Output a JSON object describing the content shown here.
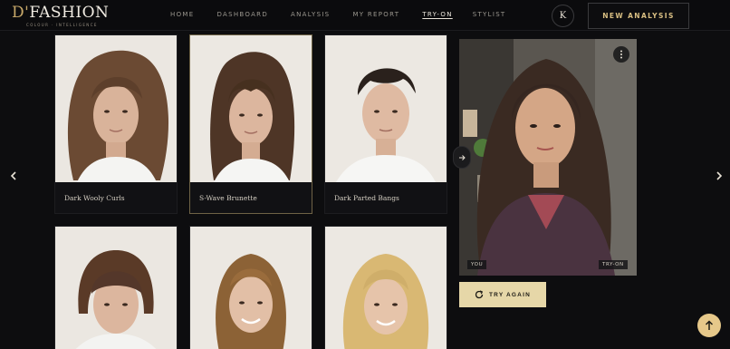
{
  "brand": {
    "name_prefix": "D'",
    "name_rest": "FASHION",
    "tagline": "COLOUR · INTELLIGENCE"
  },
  "nav": {
    "items": [
      {
        "label": "HOME",
        "active": false
      },
      {
        "label": "DASHBOARD",
        "active": false
      },
      {
        "label": "ANALYSIS",
        "active": false
      },
      {
        "label": "MY REPORT",
        "active": false
      },
      {
        "label": "TRY-ON",
        "active": true
      },
      {
        "label": "STYLIST",
        "active": false
      }
    ]
  },
  "user": {
    "initial": "K"
  },
  "actions": {
    "new_analysis": "NEW ANALYSIS",
    "try_again": "TRY AGAIN"
  },
  "styles": [
    {
      "label": "Dark Wooly Curls",
      "selected": false
    },
    {
      "label": "S-Wave Brunette",
      "selected": true
    },
    {
      "label": "Dark Parted Bangs",
      "selected": false
    },
    {
      "label": "",
      "selected": false
    },
    {
      "label": "",
      "selected": false
    },
    {
      "label": "",
      "selected": false
    }
  ],
  "preview": {
    "left_tag": "YOU",
    "right_tag": "TRY-ON"
  },
  "colors": {
    "accent_gold": "#c8a96a",
    "button_gold": "#e6d7a8",
    "scroll_button": "#e6c88a",
    "background": "#0d0d0f"
  },
  "icons": [
    "chevron-left-icon",
    "chevron-right-icon",
    "more-vertical-icon",
    "arrow-right-icon",
    "refresh-icon",
    "arrow-up-icon"
  ]
}
